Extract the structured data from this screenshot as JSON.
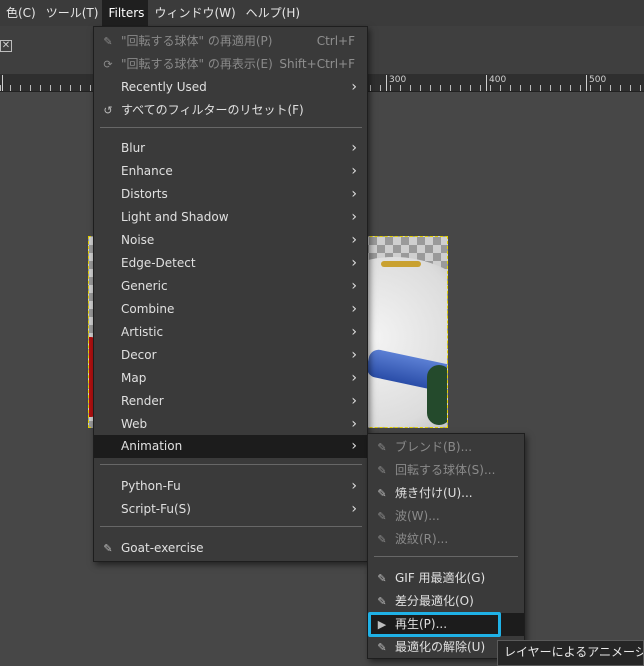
{
  "menubar": {
    "items": [
      "色(C)",
      "ツール(T)",
      "Filters",
      "ウィンドウ(W)",
      "ヘルプ(H)"
    ],
    "active": "Filters"
  },
  "ruler": {
    "labels": [
      "300",
      "400",
      "500"
    ]
  },
  "filters_menu": {
    "reapply": {
      "label": "\"回転する球体\" の再適用(P)",
      "accel": "Ctrl+F"
    },
    "reshow": {
      "label": "\"回転する球体\" の再表示(E)",
      "accel": "Shift+Ctrl+F"
    },
    "recently_used": "Recently Used",
    "reset_all": "すべてのフィルターのリセット(F)",
    "categories": [
      "Blur",
      "Enhance",
      "Distorts",
      "Light and Shadow",
      "Noise",
      "Edge-Detect",
      "Generic",
      "Combine",
      "Artistic",
      "Decor",
      "Map",
      "Render",
      "Web",
      "Animation"
    ],
    "scripting": [
      "Python-Fu",
      "Script-Fu(S)"
    ],
    "goat": "Goat-exercise"
  },
  "animation_menu": {
    "items": [
      "ブレンド(B)...",
      "回転する球体(S)...",
      "焼き付け(U)...",
      "波(W)...",
      "波紋(R)..."
    ],
    "optimize": [
      "GIF 用最適化(G)",
      "差分最適化(O)",
      "再生(P)...",
      "最適化の解除(U)"
    ]
  },
  "tooltip": "レイヤーによるアニメーション"
}
